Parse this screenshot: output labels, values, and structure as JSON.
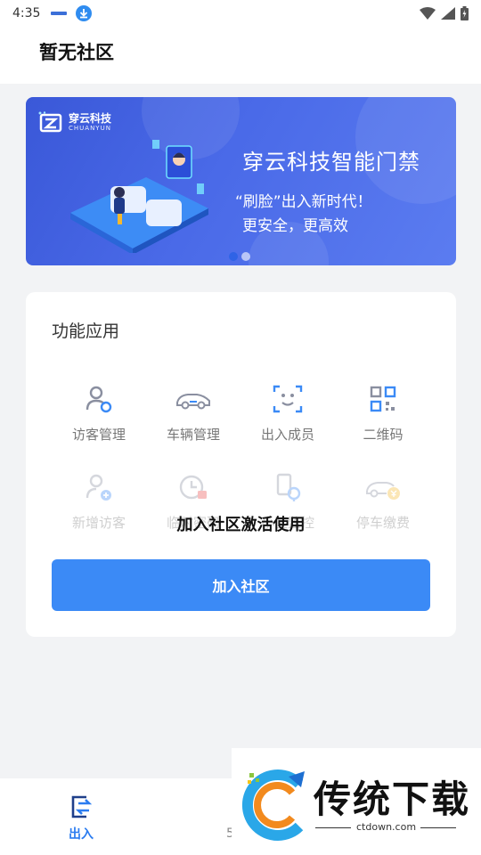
{
  "status_bar": {
    "time": "4:35"
  },
  "header": {
    "title": "暂无社区"
  },
  "banner": {
    "brand_name": "穿云科技",
    "brand_sub": "CHUANYUN",
    "title": "穿云科技智能门禁",
    "line1": "“刷脸”出入新时代！",
    "line2": "更安全，更高效",
    "slide_count": 2,
    "active_slide": 1
  },
  "functions": {
    "title": "功能应用",
    "items": [
      {
        "label": "访客管理",
        "icon": "visitor-icon"
      },
      {
        "label": "车辆管理",
        "icon": "car-icon"
      },
      {
        "label": "出入成员",
        "icon": "face-icon"
      },
      {
        "label": "二维码",
        "icon": "qrcode-icon"
      },
      {
        "label": "新增访客",
        "icon": "add-visitor-icon"
      },
      {
        "label": "临时密码",
        "icon": "temp-password-icon"
      },
      {
        "label": "小区监控",
        "icon": "monitor-icon"
      },
      {
        "label": "停车缴费",
        "icon": "parking-fee-icon"
      }
    ],
    "join_message": "加入社区激活使用",
    "join_button": "加入社区"
  },
  "bottom_nav": {
    "entry_label": "出入",
    "second_fragment": "5"
  },
  "watermark": {
    "text": "传统下载",
    "url": "ctdown.com"
  },
  "colors": {
    "accent": "#3b8af6",
    "banner": "#4a6ae8",
    "nav_active": "#2b7cf0"
  }
}
